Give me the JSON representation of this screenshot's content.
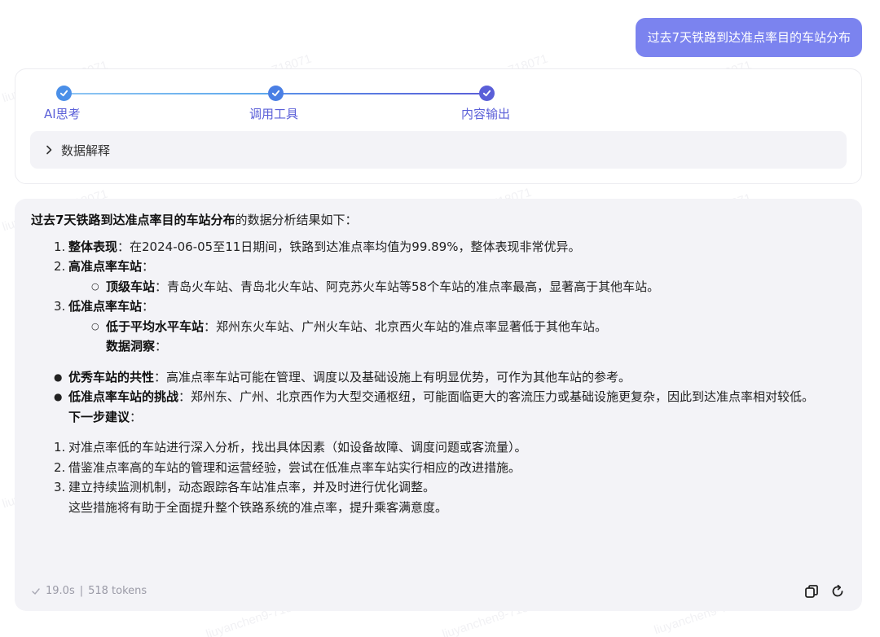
{
  "user_message": "过去7天铁路到达准点率目的车站分布",
  "steps": [
    {
      "label": "AI思考",
      "icon": "check-icon"
    },
    {
      "label": "调用工具",
      "icon": "check-icon"
    },
    {
      "label": "内容输出",
      "icon": "check-icon"
    }
  ],
  "data_explain_label": "数据解释",
  "answer": {
    "intro_bold": "过去7天铁路到达准点率目的车站分布",
    "intro_rest": "的数据分析结果如下：",
    "list1": [
      {
        "num": "1.",
        "bold": "整体表现",
        "text": "：在2024-06-05至11日期间，铁路到达准点率均值为99.89%，整体表现非常优异。"
      },
      {
        "num": "2.",
        "bold": "高准点率车站",
        "text": "："
      },
      {
        "num": "3.",
        "bold": "低准点率车站",
        "text": "："
      }
    ],
    "sub_high": {
      "bold": "顶级车站",
      "text": "：青岛火车站、青岛北火车站、阿克苏火车站等58个车站的准点率最高，显著高于其他车站。"
    },
    "sub_low": {
      "bold": "低于平均水平车站",
      "text": "：郑州东火车站、广州火车站、北京西火车站的准点率显著低于其他车站。"
    },
    "insight_heading": "数据洞察",
    "insight_colon": "：",
    "bullets": [
      {
        "bold": "优秀车站的共性",
        "text": "：高准点率车站可能在管理、调度以及基础设施上有明显优势，可作为其他车站的参考。"
      },
      {
        "bold": "低准点率车站的挑战",
        "text": "：郑州东、广州、北京西作为大型交通枢纽，可能面临更大的客流压力或基础设施更复杂，因此到达准点率相对较低。"
      }
    ],
    "next_heading": "下一步建议",
    "next_colon": "：",
    "list2": [
      {
        "num": "1.",
        "text": "对准点率低的车站进行深入分析，找出具体因素（如设备故障、调度问题或客流量）。"
      },
      {
        "num": "2.",
        "text": "借鉴准点率高的车站的管理和运营经验，尝试在低准点率车站实行相应的改进措施。"
      },
      {
        "num": "3.",
        "text": "建立持续监测机制，动态跟踪各车站准点率，并及时进行优化调整。"
      }
    ],
    "closing": "这些措施将有助于全面提升整个铁路系统的准点率，提升乘客满意度。"
  },
  "footer": {
    "duration": "19.0s",
    "separator": "|",
    "tokens": "518 tokens"
  },
  "watermark_text": "liuyanchen9-718071",
  "watermark_short": "liuyanchen9",
  "colors": {
    "accent": "#5a5fd8",
    "bubble": "#7b83ef",
    "card_bg": "#f3f3f7"
  }
}
